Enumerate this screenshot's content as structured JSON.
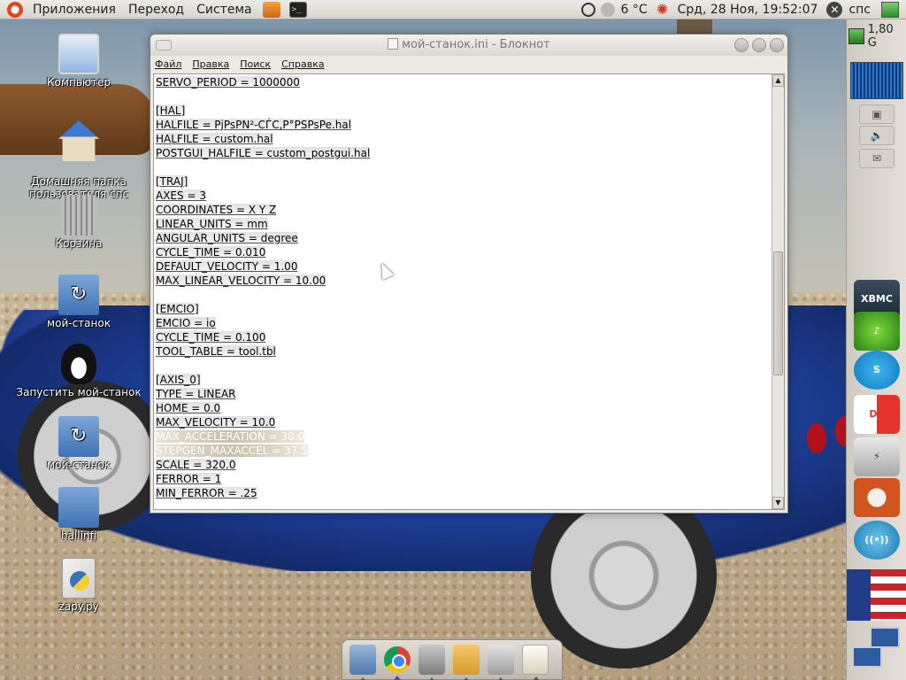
{
  "top_panel": {
    "menus": [
      "Приложения",
      "Переход",
      "Система"
    ],
    "icons": [
      "ubuntu-logo-icon",
      "toolbox-icon",
      "terminal-icon"
    ],
    "tray": {
      "weather": "6 °C",
      "datetime": "Срд, 28 Ноя, 19:52:07",
      "user": "спс"
    }
  },
  "side_panel": {
    "cpu_freq": "1,80 G",
    "apps": [
      "XBMC",
      "network-monitor",
      "Skype",
      "Double Commander",
      "terminal-link",
      "RedNotebook",
      "wireless"
    ]
  },
  "desktop_icons": [
    {
      "label": "Компьютер",
      "icon": "computer-icon"
    },
    {
      "label": "Домашняя папка\nпользователя спс",
      "icon": "home-folder-icon"
    },
    {
      "label": "Корзина",
      "icon": "trash-icon"
    },
    {
      "label": "мой-станок",
      "icon": "folder-icon"
    },
    {
      "label": "Запустить мой-станок",
      "icon": "linuxcnc-penguin-icon"
    },
    {
      "label": "мой-станок",
      "icon": "folder-icon"
    },
    {
      "label": "hallinfi",
      "icon": "folder-icon"
    },
    {
      "label": "zapy.py",
      "icon": "python-file-icon"
    }
  ],
  "window": {
    "title": "мой-станок.ini - Блокнот",
    "menu": [
      "Файл",
      "Правка",
      "Поиск",
      "Справка"
    ],
    "lines": [
      "SERVO_PERIOD = 1000000",
      "",
      "[HAL]",
      "HALFILE = PjPsPN²-CЃC,P°PSPsPe.hal",
      "HALFILE = custom.hal",
      "POSTGUI_HALFILE = custom_postgui.hal",
      "",
      "[TRAJ]",
      "AXES = 3",
      "COORDINATES = X Y Z",
      "LINEAR_UNITS = mm",
      "ANGULAR_UNITS = degree",
      "CYCLE_TIME = 0.010",
      "DEFAULT_VELOCITY = 1.00",
      "MAX_LINEAR_VELOCITY = 10.00",
      "",
      "[EMCIO]",
      "EMCIO = io",
      "CYCLE_TIME = 0.100",
      "TOOL_TABLE = tool.tbl",
      "",
      "[AXIS_0]",
      "TYPE = LINEAR",
      "HOME = 0.0",
      "MAX_VELOCITY = 10.0",
      "MAX_ACCELERATION = 30.0",
      "STEPGEN_MAXACCEL = 37.5",
      "SCALE = 320.0",
      "FERROR = 1",
      "MIN_FERROR = .25"
    ],
    "corrupt_lines": [
      25,
      26
    ]
  }
}
